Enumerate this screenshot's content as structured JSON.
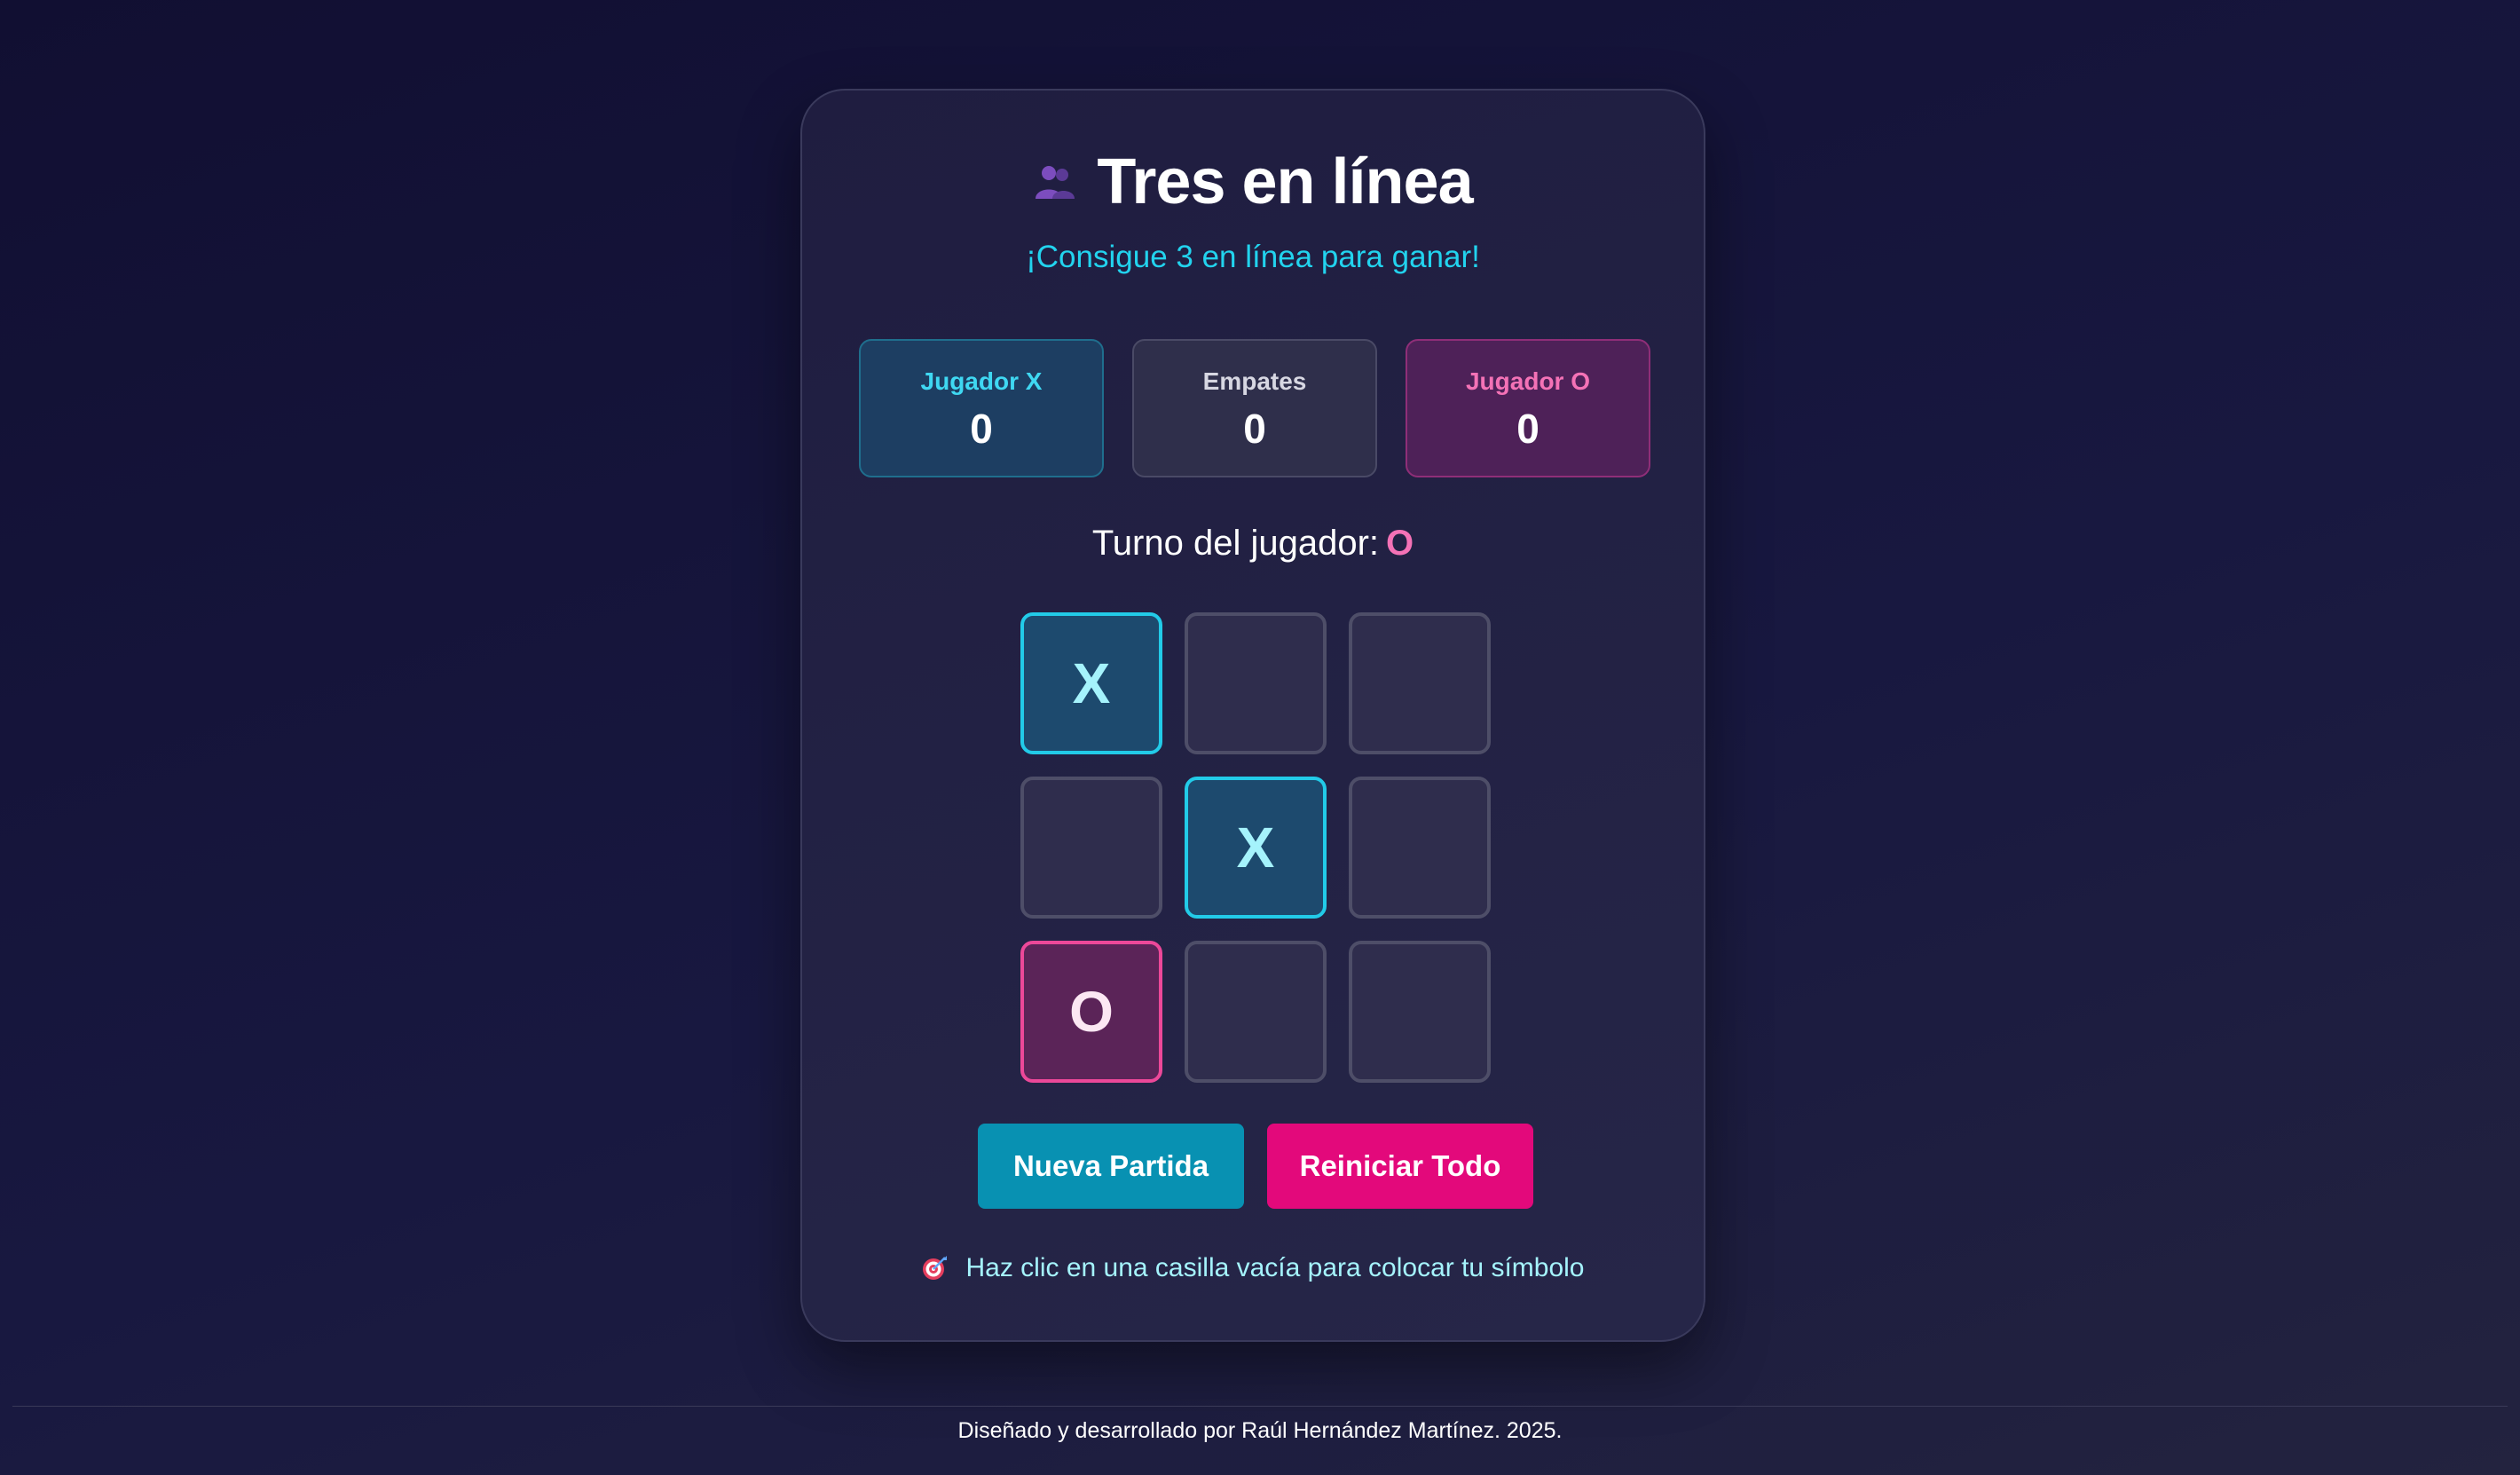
{
  "game": {
    "title": "Tres en línea",
    "title_icon": "people-icon",
    "subtitle": "¡Consigue 3 en línea para ganar!"
  },
  "scores": {
    "x": {
      "label": "Jugador X",
      "value": "0"
    },
    "draws": {
      "label": "Empates",
      "value": "0"
    },
    "o": {
      "label": "Jugador O",
      "value": "0"
    }
  },
  "turn": {
    "label": "Turno del jugador:",
    "symbol": "O"
  },
  "board": {
    "cells": [
      "X",
      "",
      "",
      "",
      "X",
      "",
      "O",
      "",
      ""
    ]
  },
  "buttons": {
    "new_game": "Nueva Partida",
    "reset_all": "Reiniciar Todo"
  },
  "hint": {
    "icon": "target-icon",
    "text": "Haz clic en una casilla vacía para colocar tu símbolo"
  },
  "footer": {
    "text": "Diseñado y desarrollado por Raúl Hernández Martínez. 2025."
  },
  "colors": {
    "x_accent": "#22d3ee",
    "o_accent": "#ec4899",
    "new_game_button": "#0891b2",
    "reset_button": "#e3097b",
    "background": "#131234"
  }
}
